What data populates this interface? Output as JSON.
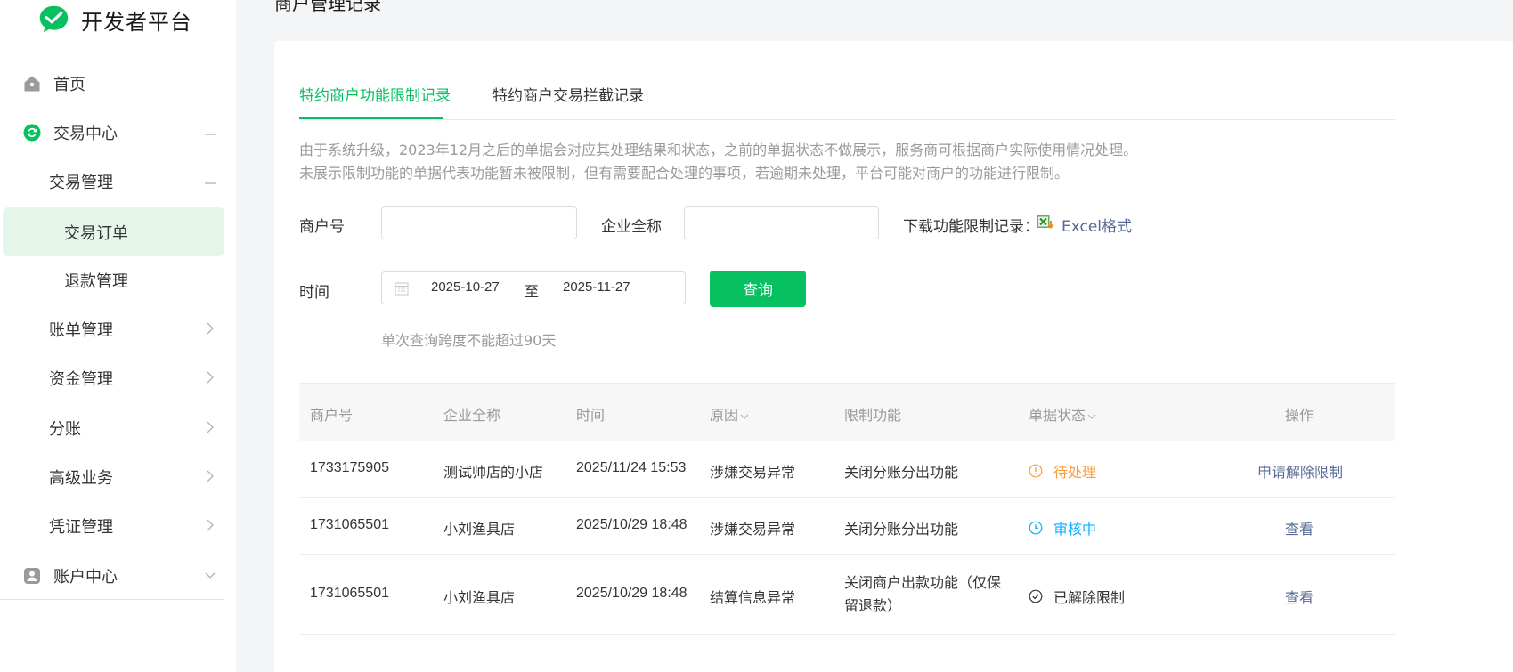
{
  "app": {
    "logo_text": "开发者平台"
  },
  "sidebar": {
    "home": "首页",
    "trade_center": "交易中心",
    "trade_mgmt": "交易管理",
    "trade_orders": "交易订单",
    "refund_mgmt": "退款管理",
    "bill_mgmt": "账单管理",
    "fund_mgmt": "资金管理",
    "profit_sharing": "分账",
    "advanced": "高级业务",
    "voucher_mgmt": "凭证管理",
    "account_center": "账户中心"
  },
  "page": {
    "title": "商户管理记录"
  },
  "tabs": [
    "特约商户功能限制记录",
    "特约商户交易拦截记录"
  ],
  "notice": {
    "line1": "由于系统升级，2023年12月之后的单据会对应其处理结果和状态，之前的单据状态不做展示，服务商可根据商户实际使用情况处理。",
    "line2": "未展示限制功能的单据代表功能暂未被限制，但有需要配合处理的事项，若逾期未处理，平台可能对商户的功能进行限制。"
  },
  "filters": {
    "merchant_label": "商户号",
    "merchant_value": "",
    "company_label": "企业全称",
    "company_value": "",
    "download_label": "下载功能限制记录：",
    "excel_link": "Excel格式",
    "time_label": "时间",
    "date_start": "2025-10-27",
    "date_sep": "至",
    "date_end": "2025-11-27",
    "query_button": "查询",
    "hint": "单次查询跨度不能超过90天"
  },
  "table": {
    "headers": [
      "商户号",
      "企业全称",
      "时间",
      "原因",
      "限制功能",
      "单据状态",
      "操作"
    ],
    "rows": [
      {
        "merchant": "1733175905",
        "company": "测试帅店的小店",
        "time": "2025/11/24 15:53",
        "reason": "涉嫌交易异常",
        "feature": "关闭分账分出功能",
        "status": "待处理",
        "status_type": "pending",
        "op": "申请解除限制"
      },
      {
        "merchant": "1731065501",
        "company": "小刘渔具店",
        "time": "2025/10/29 18:48",
        "reason": "涉嫌交易异常",
        "feature": "关闭分账分出功能",
        "status": "审核中",
        "status_type": "review",
        "op": "查看"
      },
      {
        "merchant": "1731065501",
        "company": "小刘渔具店",
        "time": "2025/10/29 18:48",
        "reason": "结算信息异常",
        "feature": "关闭商户出款功能（仅保留退款）",
        "status": "已解除限制",
        "status_type": "lifted",
        "op": "查看"
      }
    ]
  },
  "colors": {
    "brand": "#07c160",
    "link": "#576b95",
    "pending": "#fa9d3b",
    "review": "#10aeff"
  },
  "icons": [
    "wechat-logo-icon",
    "home-icon",
    "exchange-icon",
    "user-icon",
    "chevron-right-icon",
    "chevron-down-icon",
    "collapse-icon",
    "calendar-icon",
    "excel-icon",
    "warning-circle-icon",
    "clock-icon",
    "check-circle-icon",
    "sort-caret-icon"
  ]
}
